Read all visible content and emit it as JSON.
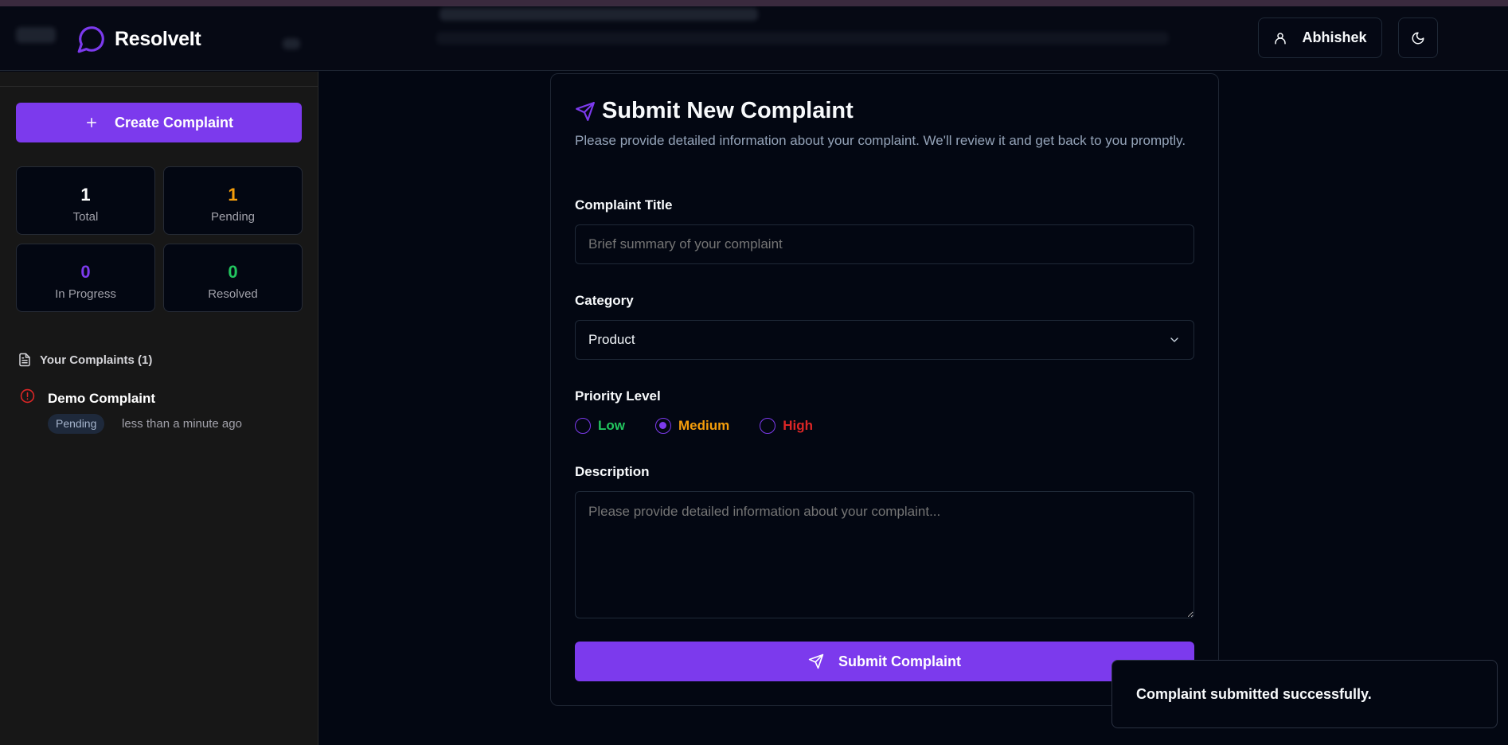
{
  "colors": {
    "accent": "#7c3aed",
    "pending": "#f59e0b",
    "in_progress": "#7c3aed",
    "resolved": "#22c55e",
    "low": "#22c55e",
    "medium": "#f59e0b",
    "high": "#dc2626"
  },
  "header": {
    "brand": "ResolveIt",
    "user_name": "Abhishek",
    "logo_icon": "message-circle-icon",
    "theme_icon": "moon-icon"
  },
  "sidebar": {
    "create_label": "Create Complaint",
    "stats": [
      {
        "value": "1",
        "label": "Total"
      },
      {
        "value": "1",
        "label": "Pending"
      },
      {
        "value": "0",
        "label": "In Progress"
      },
      {
        "value": "0",
        "label": "Resolved"
      }
    ],
    "list_title": "Your Complaints (1)",
    "complaints": [
      {
        "title": "Demo Complaint",
        "status": "Pending",
        "time": "less than a minute ago"
      }
    ]
  },
  "form": {
    "title": "Submit New Complaint",
    "subtitle": "Please provide detailed information about your complaint. We'll review it and get back to you promptly.",
    "title_label": "Complaint Title",
    "title_placeholder": "Brief summary of your complaint",
    "category_label": "Category",
    "category_value": "Product",
    "priority_label": "Priority Level",
    "priorities": [
      "Low",
      "Medium",
      "High"
    ],
    "selected_priority": "Medium",
    "description_label": "Description",
    "description_placeholder": "Please provide detailed information about your complaint...",
    "submit_label": "Submit Complaint"
  },
  "toast": {
    "message": "Complaint submitted successfully."
  }
}
